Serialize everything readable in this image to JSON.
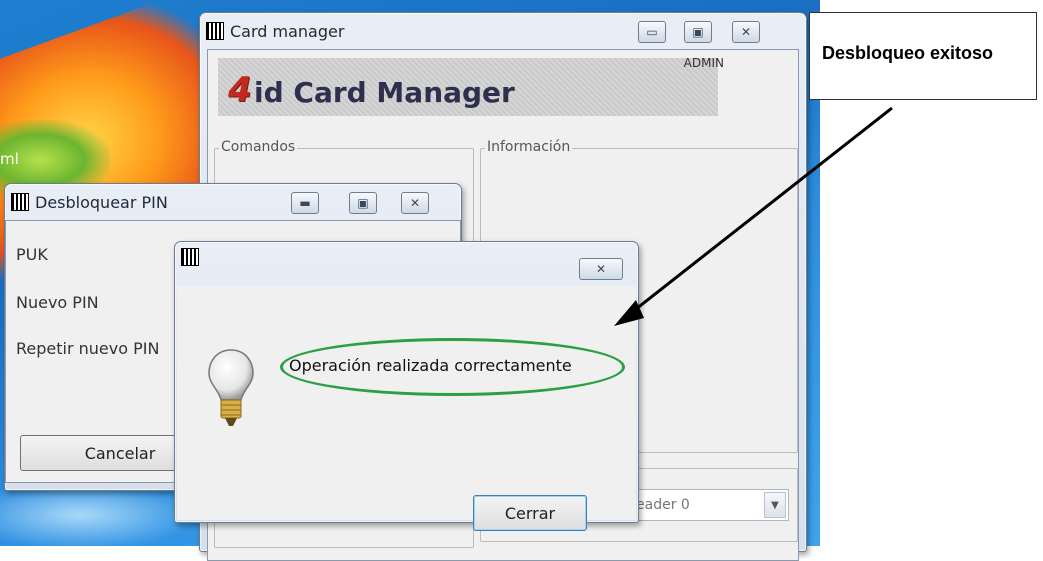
{
  "desktop": {
    "fragment_text": "ml"
  },
  "card_manager": {
    "title": "Card manager",
    "logo_prefix": "4",
    "logo_text": "id Card Manager",
    "role": "ADMIN",
    "groups": {
      "commands": "Comandos",
      "info": "Información"
    },
    "reader_value": "eader 0"
  },
  "unlock_pin": {
    "title": "Desbloquear PIN",
    "fields": {
      "puk": "PUK",
      "new_pin": "Nuevo PIN",
      "repeat_pin": "Repetir nuevo PIN"
    },
    "cancel_label": "Cancelar"
  },
  "message_box": {
    "message": "Operación realizada correctamente",
    "close_label": "Cerrar",
    "highlight_color": "#2aa043"
  },
  "annotation": {
    "callout_text": "Desbloqueo exitoso"
  },
  "icons": {
    "window_controls": [
      "minimize-icon",
      "maximize-icon",
      "close-icon"
    ],
    "message_icon": "lightbulb-icon"
  }
}
